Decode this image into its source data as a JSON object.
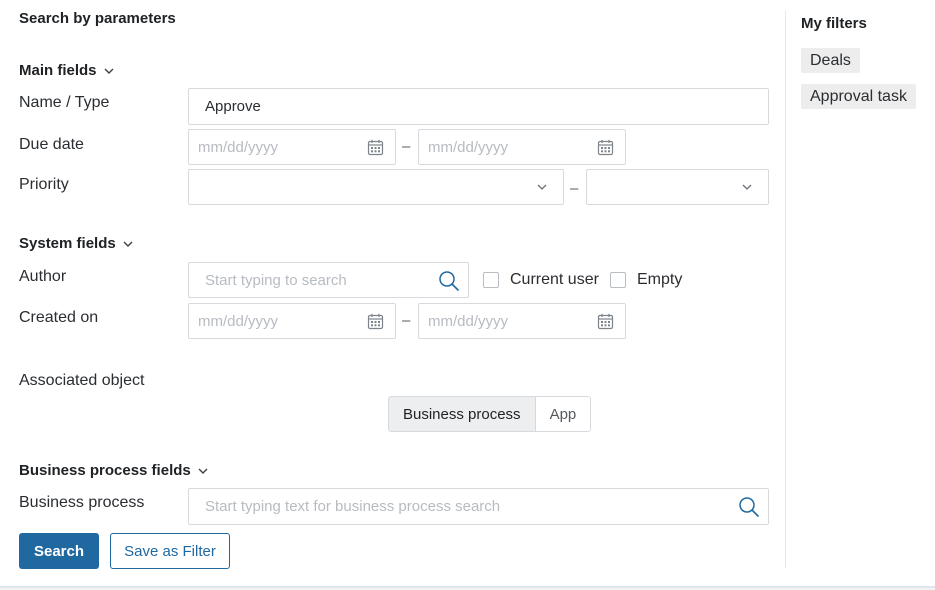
{
  "panel": {
    "title": "Search by parameters"
  },
  "sections": {
    "main": "Main fields",
    "system": "System fields",
    "bp": "Business process fields"
  },
  "fields": {
    "name_type": {
      "label": "Name / Type",
      "value": "Approve"
    },
    "due_date": {
      "label": "Due date",
      "from_placeholder": "mm/dd/yyyy",
      "to_placeholder": "mm/dd/yyyy",
      "separator": "–"
    },
    "priority": {
      "label": "Priority",
      "from_value": "",
      "to_value": "",
      "separator": "–"
    },
    "author": {
      "label": "Author",
      "placeholder": "Start typing to search",
      "current_user_label": "Current user",
      "empty_label": "Empty",
      "current_user_checked": false,
      "empty_checked": false
    },
    "created_on": {
      "label": "Created on",
      "from_placeholder": "mm/dd/yyyy",
      "to_placeholder": "mm/dd/yyyy",
      "separator": "–"
    },
    "associated_object": {
      "label": "Associated object",
      "options": [
        "Business process",
        "App"
      ],
      "selected": "Business process"
    },
    "business_process": {
      "label": "Business process",
      "placeholder": "Start typing text for business process search"
    }
  },
  "actions": {
    "search": "Search",
    "save_filter": "Save as Filter"
  },
  "my_filters": {
    "title": "My filters",
    "items": [
      "Deals",
      "Approval task"
    ]
  },
  "icons": {
    "calendar": "calendar-icon",
    "search": "search-icon",
    "chevron": "chevron-down-icon"
  },
  "colors": {
    "primary": "#2069a0",
    "chip_bg": "#ededed",
    "segment_active_bg": "#eceeef"
  }
}
